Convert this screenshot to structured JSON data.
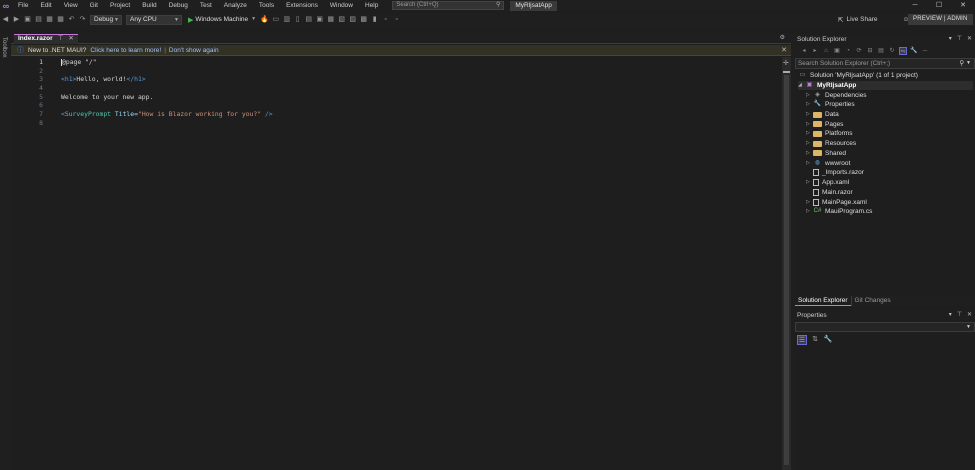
{
  "titlebar": {
    "menu": [
      "File",
      "Edit",
      "View",
      "Git",
      "Project",
      "Build",
      "Debug",
      "Test",
      "Analyze",
      "Tools",
      "Extensions",
      "Window",
      "Help"
    ],
    "search_text": "Search (Ctrl+Q)",
    "app_name": "MyRljsatApp"
  },
  "toolbar": {
    "config": "Debug",
    "platform": "Any CPU",
    "run_target": "Windows Machine",
    "live_share": "Live Share",
    "preview_admin": "PREVIEW | ADMIN"
  },
  "toolbox_label": "Toolbox",
  "editor_tab": {
    "label": "Index.razor"
  },
  "infobar": {
    "message": "New to .NET MAUI?",
    "learn_link": "Click here to learn more!",
    "separator": "|",
    "dismiss_link": "Don't show again"
  },
  "editor": {
    "lines": [
      {
        "n": "1",
        "parts": [
          {
            "t": "@page \"/\"",
            "c": "at"
          }
        ]
      },
      {
        "n": "2",
        "parts": []
      },
      {
        "n": "3",
        "parts": [
          {
            "t": "<h1>",
            "c": "tagc"
          },
          {
            "t": "Hello, world!",
            "c": "at"
          },
          {
            "t": "</h1>",
            "c": "tagc"
          }
        ]
      },
      {
        "n": "4",
        "parts": []
      },
      {
        "n": "5",
        "parts": [
          {
            "t": "Welcome to your new app.",
            "c": "at"
          }
        ]
      },
      {
        "n": "6",
        "parts": []
      },
      {
        "n": "7",
        "parts": [
          {
            "t": "<",
            "c": "tagc"
          },
          {
            "t": "SurveyPrompt",
            "c": "comp"
          },
          {
            "t": " Title=",
            "c": "attr"
          },
          {
            "t": "\"How is Blazor working for you?\"",
            "c": "str"
          },
          {
            "t": " />",
            "c": "tagc"
          }
        ]
      },
      {
        "n": "8",
        "parts": []
      }
    ]
  },
  "solution_explorer": {
    "title": "Solution Explorer",
    "search_placeholder": "Search Solution Explorer (Ctrl+;)",
    "solution_label": "Solution 'MyRljsatApp' (1 of 1 project)",
    "project": "MyRljsatApp",
    "items": [
      {
        "label": "Dependencies",
        "kind": "deps",
        "expandable": true
      },
      {
        "label": "Properties",
        "kind": "props",
        "expandable": true
      },
      {
        "label": "Data",
        "kind": "folder",
        "expandable": true
      },
      {
        "label": "Pages",
        "kind": "folder",
        "expandable": true
      },
      {
        "label": "Platforms",
        "kind": "folder",
        "expandable": true
      },
      {
        "label": "Resources",
        "kind": "folder",
        "expandable": true
      },
      {
        "label": "Shared",
        "kind": "folder",
        "expandable": true
      },
      {
        "label": "wwwroot",
        "kind": "web",
        "expandable": true
      },
      {
        "label": "_Imports.razor",
        "kind": "file",
        "expandable": false
      },
      {
        "label": "App.xaml",
        "kind": "file",
        "expandable": true
      },
      {
        "label": "Main.razor",
        "kind": "file",
        "expandable": false
      },
      {
        "label": "MainPage.xaml",
        "kind": "file",
        "expandable": true
      },
      {
        "label": "MauiProgram.cs",
        "kind": "cs",
        "expandable": true
      }
    ],
    "tabs": [
      "Solution Explorer",
      "Git Changes"
    ]
  },
  "properties": {
    "title": "Properties"
  },
  "colors": {
    "accent": "#c678dd",
    "infobar_bg": "#333024",
    "folder": "#dcb567"
  }
}
